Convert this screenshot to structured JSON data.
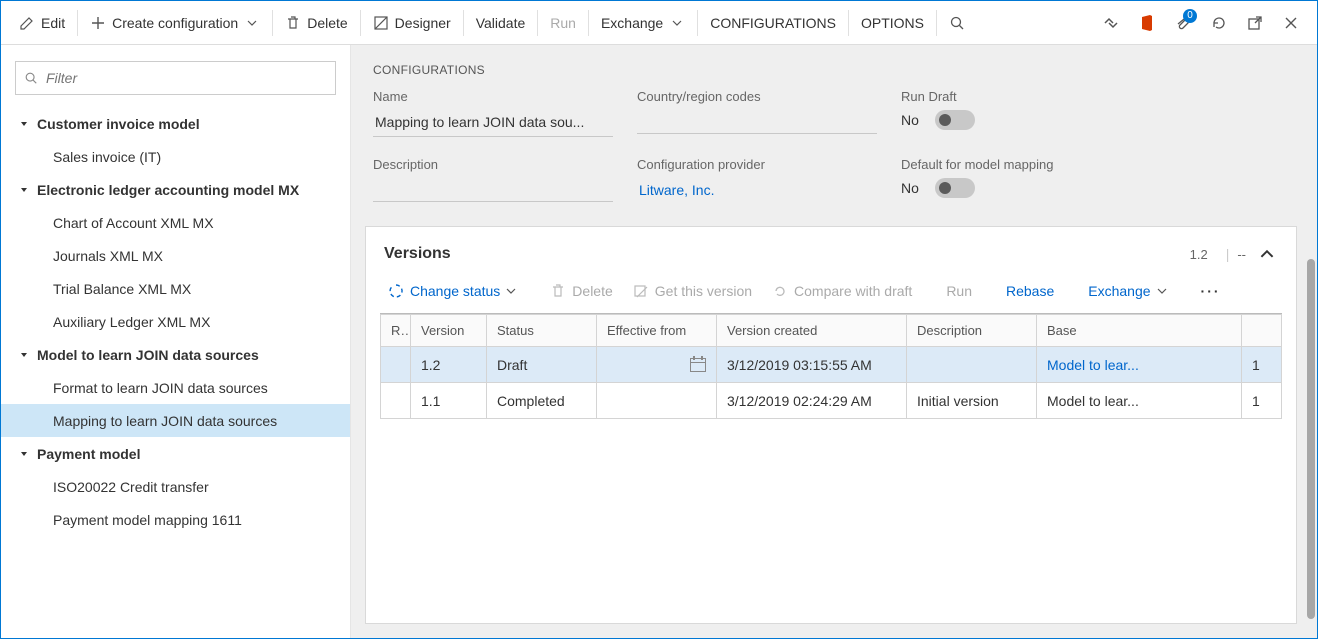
{
  "toolbar": {
    "edit": "Edit",
    "create_config": "Create configuration",
    "delete": "Delete",
    "designer": "Designer",
    "validate": "Validate",
    "run": "Run",
    "exchange": "Exchange",
    "configurations": "CONFIGURATIONS",
    "options": "OPTIONS",
    "attachments_badge": "0"
  },
  "filter": {
    "placeholder": "Filter"
  },
  "tree": [
    {
      "label": "Customer invoice model",
      "level": 0,
      "bold": true,
      "expanded": true
    },
    {
      "label": "Sales invoice (IT)",
      "level": 1
    },
    {
      "label": "Electronic ledger accounting model MX",
      "level": 0,
      "bold": true,
      "expanded": true
    },
    {
      "label": "Chart of Account XML MX",
      "level": 1
    },
    {
      "label": "Journals XML MX",
      "level": 1
    },
    {
      "label": "Trial Balance XML MX",
      "level": 1
    },
    {
      "label": "Auxiliary Ledger XML MX",
      "level": 1
    },
    {
      "label": "Model to learn JOIN data sources",
      "level": 0,
      "bold": true,
      "expanded": true
    },
    {
      "label": "Format to learn JOIN data sources",
      "level": 1
    },
    {
      "label": "Mapping to learn JOIN data sources",
      "level": 1,
      "selected": true
    },
    {
      "label": "Payment model",
      "level": 0,
      "bold": true,
      "expanded": true
    },
    {
      "label": "ISO20022 Credit transfer",
      "level": 1
    },
    {
      "label": "Payment model mapping 1611",
      "level": 1
    }
  ],
  "config": {
    "section": "CONFIGURATIONS",
    "labels": {
      "name": "Name",
      "country": "Country/region codes",
      "run_draft": "Run Draft",
      "description": "Description",
      "provider": "Configuration provider",
      "default_mapping": "Default for model mapping"
    },
    "name_value": "Mapping to learn JOIN data sou...",
    "country_value": "",
    "run_draft_value": "No",
    "description_value": "",
    "provider_value": "Litware, Inc.",
    "default_mapping_value": "No"
  },
  "versions": {
    "title": "Versions",
    "header_version": "1.2",
    "header_extra": "--",
    "toolbar": {
      "change_status": "Change status",
      "delete": "Delete",
      "get_version": "Get this version",
      "compare": "Compare with draft",
      "run": "Run",
      "rebase": "Rebase",
      "exchange": "Exchange"
    },
    "columns": {
      "r": "R...",
      "version": "Version",
      "status": "Status",
      "effective": "Effective from",
      "created": "Version created",
      "description": "Description",
      "base": "Base"
    },
    "rows": [
      {
        "version": "1.2",
        "status": "Draft",
        "effective": "",
        "created": "3/12/2019 03:15:55 AM",
        "description": "",
        "base": "Model to lear...",
        "base_n": "1",
        "selected": true
      },
      {
        "version": "1.1",
        "status": "Completed",
        "effective": "",
        "created": "3/12/2019 02:24:29 AM",
        "description": "Initial version",
        "base": "Model to lear...",
        "base_n": "1"
      }
    ]
  }
}
